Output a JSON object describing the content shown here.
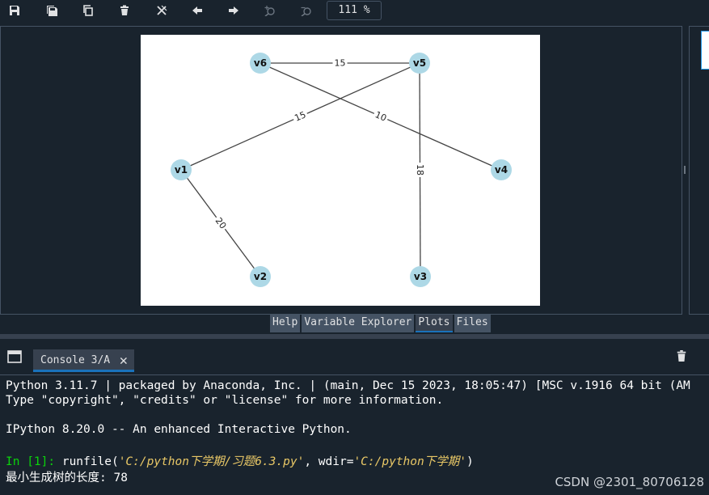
{
  "toolbar": {
    "zoom": "111 %",
    "icons": [
      "save-icon",
      "save-all-icon",
      "copy-icon",
      "delete-icon",
      "delete-all-icon",
      "previous-icon",
      "next-icon",
      "zoom-in-icon",
      "zoom-out-icon"
    ]
  },
  "graph": {
    "nodes": [
      {
        "id": "v1",
        "label": "v1"
      },
      {
        "id": "v2",
        "label": "v2"
      },
      {
        "id": "v3",
        "label": "v3"
      },
      {
        "id": "v4",
        "label": "v4"
      },
      {
        "id": "v5",
        "label": "v5"
      },
      {
        "id": "v6",
        "label": "v6"
      }
    ],
    "edges": [
      {
        "from": "v6",
        "to": "v5",
        "weight": "15"
      },
      {
        "from": "v1",
        "to": "v5",
        "weight": "15"
      },
      {
        "from": "v6",
        "to": "v4",
        "weight": "10"
      },
      {
        "from": "v5",
        "to": "v3",
        "weight": "18"
      },
      {
        "from": "v1",
        "to": "v2",
        "weight": "20"
      }
    ],
    "node_color": "#add8e6",
    "edge_color": "#444444"
  },
  "pane_tabs": [
    "Help",
    "Variable Explorer",
    "Plots",
    "Files"
  ],
  "active_pane_tab": "Plots",
  "console": {
    "tab_label": "Console 3/A",
    "close_glyph": "✕",
    "line1": "Python 3.11.7 | packaged by Anaconda, Inc. | (main, Dec 15 2023, 18:05:47) [MSC v.1916 64 bit (AM",
    "line2": "Type \"copyright\", \"credits\" or \"license\" for more information.",
    "line3": "IPython 8.20.0 -- An enhanced Interactive Python.",
    "prompt": "In [1]:",
    "cmd_pre": " runfile(",
    "arg1": "'C:/python下学期/习题6.3.py'",
    "cmd_mid": ", wdir=",
    "arg2": "'C:/python下学期'",
    "cmd_post": ")",
    "result": "最小生成树的长度: 78"
  },
  "watermark": "CSDN @2301_80706128"
}
